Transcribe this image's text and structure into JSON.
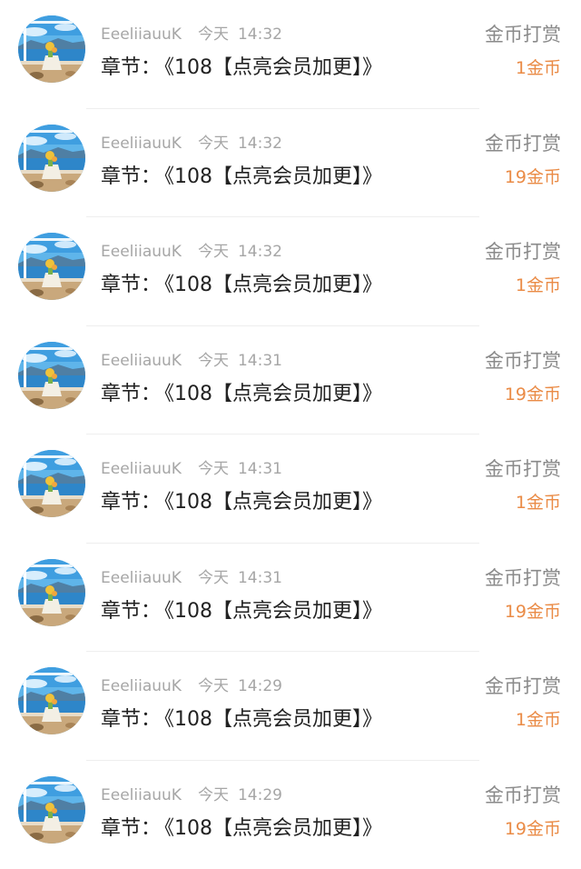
{
  "colors": {
    "amount": "#ea8b46",
    "meta": "#a6a6a6",
    "chapter": "#222222",
    "type_label": "#8a8a8a"
  },
  "avatar_icon": "beach-view-avatar",
  "records": [
    {
      "user": "EeeliiauuK",
      "day": "今天",
      "time": "14:32",
      "chapter_prefix": "章节：",
      "chapter_title": "《108【点亮会员加更】》",
      "type": "金币打赏",
      "amount": "1金币"
    },
    {
      "user": "EeeliiauuK",
      "day": "今天",
      "time": "14:32",
      "chapter_prefix": "章节：",
      "chapter_title": "《108【点亮会员加更】》",
      "type": "金币打赏",
      "amount": "19金币"
    },
    {
      "user": "EeeliiauuK",
      "day": "今天",
      "time": "14:32",
      "chapter_prefix": "章节：",
      "chapter_title": "《108【点亮会员加更】》",
      "type": "金币打赏",
      "amount": "1金币"
    },
    {
      "user": "EeeliiauuK",
      "day": "今天",
      "time": "14:31",
      "chapter_prefix": "章节：",
      "chapter_title": "《108【点亮会员加更】》",
      "type": "金币打赏",
      "amount": "19金币"
    },
    {
      "user": "EeeliiauuK",
      "day": "今天",
      "time": "14:31",
      "chapter_prefix": "章节：",
      "chapter_title": "《108【点亮会员加更】》",
      "type": "金币打赏",
      "amount": "1金币"
    },
    {
      "user": "EeeliiauuK",
      "day": "今天",
      "time": "14:31",
      "chapter_prefix": "章节：",
      "chapter_title": "《108【点亮会员加更】》",
      "type": "金币打赏",
      "amount": "19金币"
    },
    {
      "user": "EeeliiauuK",
      "day": "今天",
      "time": "14:29",
      "chapter_prefix": "章节：",
      "chapter_title": "《108【点亮会员加更】》",
      "type": "金币打赏",
      "amount": "1金币"
    },
    {
      "user": "EeeliiauuK",
      "day": "今天",
      "time": "14:29",
      "chapter_prefix": "章节：",
      "chapter_title": "《108【点亮会员加更】》",
      "type": "金币打赏",
      "amount": "19金币"
    }
  ]
}
